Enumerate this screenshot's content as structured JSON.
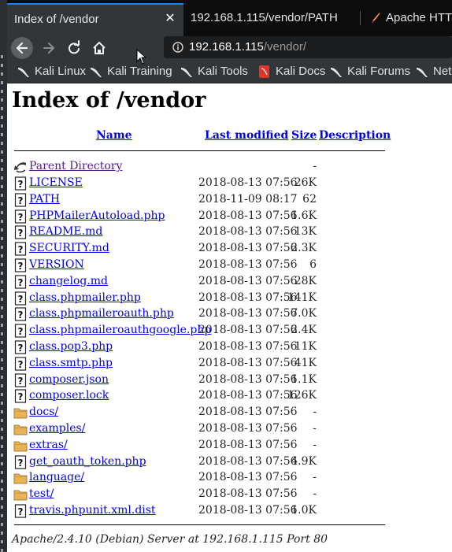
{
  "window": {
    "accent_color": "#0a84ff",
    "link_color": "#0000ee",
    "visited_color": "#551a8b"
  },
  "tabs": [
    {
      "title": "Index of /vendor",
      "active": true,
      "close_icon": "close-icon"
    },
    {
      "title": "192.168.1.115/vendor/PATH",
      "active": false
    },
    {
      "title": "Apache HTTP",
      "active": false,
      "icon": "apache-feather-icon"
    }
  ],
  "nav": {
    "back_icon": "back-arrow-icon",
    "forward_icon": "forward-arrow-icon",
    "reload_icon": "reload-icon",
    "home_icon": "home-icon",
    "url_host": "192.168.1.115",
    "url_path": "/vendor/"
  },
  "bookmarks": [
    {
      "label": "Kali Linux",
      "icon": "kali-dragon-icon"
    },
    {
      "label": "Kali Training",
      "icon": "kali-dragon-icon"
    },
    {
      "label": "Kali Tools",
      "icon": "kali-dragon-icon"
    },
    {
      "label": "Kali Docs",
      "icon": "kali-docs-icon"
    },
    {
      "label": "Kali Forums",
      "icon": "kali-dragon-icon"
    },
    {
      "label": "Net",
      "icon": "kali-dragon-icon"
    }
  ],
  "page": {
    "title": "Index of /vendor",
    "columns": {
      "name": "Name",
      "modified": "Last modified",
      "size": "Size",
      "description": "Description"
    },
    "parent": {
      "name": "Parent Directory",
      "size": "-"
    },
    "entries": [
      {
        "name": "LICENSE",
        "date": "2018-08-13 07:56",
        "size": "26K",
        "type": "file"
      },
      {
        "name": "PATH",
        "date": "2018-11-09 08:17",
        "size": "62",
        "type": "file"
      },
      {
        "name": "PHPMailerAutoload.php",
        "date": "2018-08-13 07:56",
        "size": "1.6K",
        "type": "file"
      },
      {
        "name": "README.md",
        "date": "2018-08-13 07:56",
        "size": "13K",
        "type": "file"
      },
      {
        "name": "SECURITY.md",
        "date": "2018-08-13 07:56",
        "size": "2.3K",
        "type": "file"
      },
      {
        "name": "VERSION",
        "date": "2018-08-13 07:56",
        "size": "6",
        "type": "file"
      },
      {
        "name": "changelog.md",
        "date": "2018-08-13 07:56",
        "size": "28K",
        "type": "file"
      },
      {
        "name": "class.phpmailer.php",
        "date": "2018-08-13 07:56",
        "size": "141K",
        "type": "file"
      },
      {
        "name": "class.phpmaileroauth.php",
        "date": "2018-08-13 07:56",
        "size": "7.0K",
        "type": "file"
      },
      {
        "name": "class.phpmaileroauthgoogle.php",
        "date": "2018-08-13 07:56",
        "size": "2.4K",
        "type": "file"
      },
      {
        "name": "class.pop3.php",
        "date": "2018-08-13 07:56",
        "size": "11K",
        "type": "file"
      },
      {
        "name": "class.smtp.php",
        "date": "2018-08-13 07:56",
        "size": "41K",
        "type": "file"
      },
      {
        "name": "composer.json",
        "date": "2018-08-13 07:56",
        "size": "1.1K",
        "type": "file"
      },
      {
        "name": "composer.lock",
        "date": "2018-08-13 07:56",
        "size": "126K",
        "type": "file"
      },
      {
        "name": "docs/",
        "date": "2018-08-13 07:56",
        "size": "-",
        "type": "folder"
      },
      {
        "name": "examples/",
        "date": "2018-08-13 07:56",
        "size": "-",
        "type": "folder"
      },
      {
        "name": "extras/",
        "date": "2018-08-13 07:56",
        "size": "-",
        "type": "folder"
      },
      {
        "name": "get_oauth_token.php",
        "date": "2018-08-13 07:56",
        "size": "4.9K",
        "type": "file"
      },
      {
        "name": "language/",
        "date": "2018-08-13 07:56",
        "size": "-",
        "type": "folder"
      },
      {
        "name": "test/",
        "date": "2018-08-13 07:56",
        "size": "-",
        "type": "folder"
      },
      {
        "name": "travis.phpunit.xml.dist",
        "date": "2018-08-13 07:56",
        "size": "1.0K",
        "type": "file"
      }
    ],
    "footer": "Apache/2.4.10 (Debian) Server at 192.168.1.115 Port 80"
  }
}
